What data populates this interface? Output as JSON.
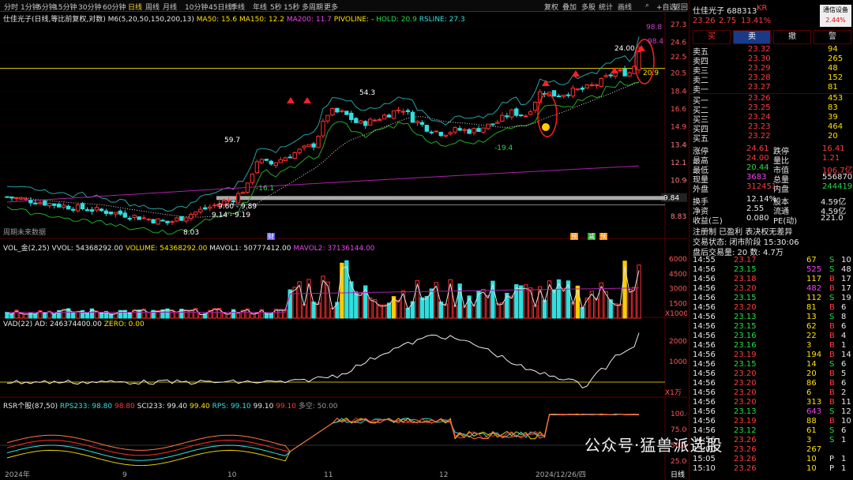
{
  "toolbar": {
    "timeframes": [
      "分时",
      "1分钟",
      "5分钟",
      "15分钟",
      "30分钟",
      "60分钟",
      "日线",
      "周线",
      "月线",
      "10分钟",
      "45日线",
      "季线",
      "年线",
      "5秒",
      "15秒",
      "多周期",
      "更多"
    ],
    "active": "日线",
    "right_items": [
      "复权",
      "叠加",
      "多股",
      "统计",
      "画线",
      "",
      "+自选",
      "返回"
    ],
    "search_icon": "search-icon"
  },
  "main_chart": {
    "title": "仕佳光子(日线,等比前复权,对数)",
    "indicator_name": "M6(5,20,50,150,200,13)",
    "ma50": "MA50: 15.6",
    "ma150": "MA150: 12.2",
    "ma200": "MA200: 11.7",
    "pivoline": "PIVOLINE: -",
    "hold": "HOLD: 20.9",
    "rsline": "RSLINE: 27.3",
    "price_labels": [
      "27.32",
      "24.61",
      "22.56",
      "20.51",
      "18.46",
      "16.61",
      "14.95",
      "13.46",
      "12.11",
      "10.90",
      "9.84",
      "8.83"
    ],
    "price_tag": "9.84",
    "annotations": [
      "98.8",
      "98.4",
      "24.00",
      "20.9",
      "54.3",
      "59.7",
      "-16.1",
      "-19.4",
      "9.60 - 9.89",
      "9.14 - 9.19",
      "8.03"
    ],
    "footer_note": "周期未来数据",
    "event_tags": [
      "财",
      "预",
      "减",
      "预"
    ]
  },
  "vol_panel": {
    "header": "VOL_金(2,25)",
    "vvol": "VVOL: 54368292.00",
    "volume": "VOLUME: 54368292.00",
    "mavol1": "MAVOL1: 50777412.00",
    "mavol2": "MAVOL2: 37136144.00",
    "axis": [
      "60000",
      "45000",
      "30000",
      "15000"
    ],
    "unit": "X1000"
  },
  "vad_panel": {
    "header": "VAD(22)",
    "ad": "AD: 246374400.00",
    "zero": "ZERO: 0.00",
    "axis": [
      "20000",
      "10000"
    ],
    "unit": "X1万"
  },
  "rsr_panel": {
    "header": "RSR个股(87,50)",
    "rps233": "RPS233: 98.80",
    "v1": "98.80",
    "sci233": "SCI233: 99.40",
    "v2": "99.40",
    "rps": "RPS: 99.10",
    "v3": "99.10",
    "v4": "99.10",
    "duokong": "多空: 50.00",
    "axis": [
      "100.0",
      "75.00",
      "50.00",
      "25.00"
    ]
  },
  "x_axis": {
    "labels": [
      "2024年",
      "9",
      "10",
      "11",
      "12",
      "2024/12/26/四"
    ],
    "period": "日线"
  },
  "quote": {
    "name": "仕佳光子",
    "code": "688313",
    "suffix": "KR",
    "price": "23.26",
    "change": "2.75",
    "pct": "13.41%",
    "badge": "通信设备",
    "badge_pct": "2.44%",
    "buttons": [
      "买",
      "卖",
      "撤",
      "警"
    ],
    "asks": [
      [
        "卖五",
        "23.32",
        "94"
      ],
      [
        "卖四",
        "23.30",
        "265"
      ],
      [
        "卖三",
        "23.29",
        "48"
      ],
      [
        "卖二",
        "23.28",
        "152"
      ],
      [
        "卖一",
        "23.27",
        "81"
      ]
    ],
    "bids": [
      [
        "买一",
        "23.26",
        "453"
      ],
      [
        "买二",
        "23.25",
        "83"
      ],
      [
        "买三",
        "23.24",
        "39"
      ],
      [
        "买四",
        "23.23",
        "464"
      ],
      [
        "买五",
        "23.22",
        "20"
      ]
    ],
    "stats": [
      [
        "涨停",
        "24.61",
        "跌停",
        "16.41"
      ],
      [
        "最高",
        "24.00",
        "量比",
        "1.21"
      ],
      [
        "最低",
        "20.44",
        "市值",
        "106.7亿"
      ],
      [
        "现量",
        "3683",
        "总量",
        "556870"
      ],
      [
        "外盘",
        "312451",
        "内盘",
        "244419"
      ]
    ],
    "stats2": [
      [
        "换手",
        "12.14%",
        "股本",
        "4.59亿"
      ],
      [
        "净资",
        "2.55",
        "流通",
        "4.59亿"
      ],
      [
        "收益(三)",
        "0.080",
        "PE(动)",
        "221.0"
      ]
    ],
    "tags": "注册制 已盈利 表决权无差异",
    "status": "交易状态: 闭市阶段 15:30:06",
    "after": "盘后交易量: 20  数: 4.7万"
  },
  "ticks": [
    [
      "14:55",
      "23.17",
      "67",
      "S",
      "10"
    ],
    [
      "14:56",
      "23.15",
      "525",
      "S",
      "48"
    ],
    [
      "14:56",
      "23.18",
      "117",
      "B",
      "17"
    ],
    [
      "14:56",
      "23.20",
      "482",
      "B",
      "17"
    ],
    [
      "14:56",
      "23.15",
      "112",
      "S",
      "19"
    ],
    [
      "14:56",
      "23.20",
      "81",
      "B",
      "6"
    ],
    [
      "14:56",
      "23.13",
      "13",
      "S",
      "8"
    ],
    [
      "14:56",
      "23.15",
      "62",
      "B",
      "6"
    ],
    [
      "14:56",
      "23.16",
      "22",
      "B",
      "4"
    ],
    [
      "14:56",
      "23.16",
      "3",
      "B",
      "1"
    ],
    [
      "14:56",
      "23.19",
      "194",
      "B",
      "14"
    ],
    [
      "14:56",
      "23.15",
      "14",
      "S",
      "6"
    ],
    [
      "14:56",
      "23.20",
      "20",
      "B",
      "5"
    ],
    [
      "14:56",
      "23.20",
      "86",
      "B",
      "6"
    ],
    [
      "14:56",
      "23.20",
      "6",
      "B",
      "2"
    ],
    [
      "14:56",
      "23.20",
      "313",
      "B",
      "11"
    ],
    [
      "14:56",
      "23.13",
      "643",
      "S",
      "12"
    ],
    [
      "14:56",
      "23.19",
      "88",
      "B",
      "10"
    ],
    [
      "14:56",
      "23.12",
      "61",
      "S",
      "6"
    ],
    [
      "14:56",
      "23.26",
      "3",
      "S",
      "1"
    ],
    [
      "15:00",
      "23.26",
      "267",
      "",
      ""
    ],
    [
      "15:05",
      "23.26",
      "10",
      "P",
      "1"
    ],
    [
      "15:10",
      "23.26",
      "10",
      "P",
      "1"
    ]
  ],
  "watermark": "公众号·猛兽派选股",
  "chart_data": {
    "type": "candlestick",
    "price_scale": "log",
    "ylim": [
      8.83,
      27.32
    ],
    "close_last": 23.26,
    "high_last": 24.0,
    "low_last": 20.44
  }
}
